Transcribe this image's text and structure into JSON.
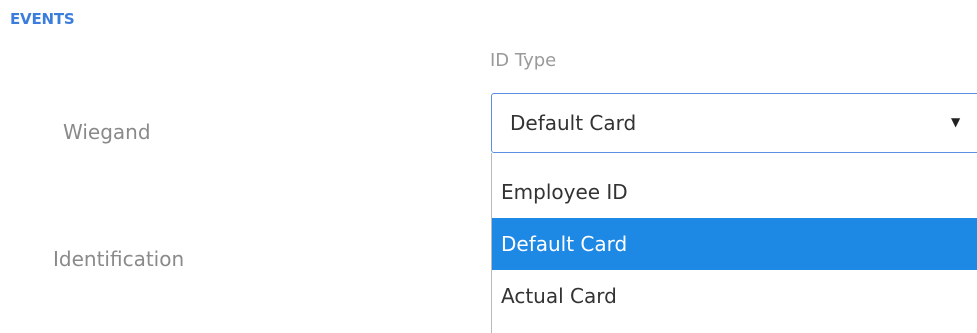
{
  "section": {
    "title": "EVENTS"
  },
  "columns": {
    "id_type_header": "ID Type"
  },
  "rows": [
    {
      "label": "Wiegand"
    },
    {
      "label": "Identification"
    }
  ],
  "id_type_select": {
    "value": "Default Card",
    "caret_icon": "caret-down-icon",
    "options": [
      "Employee ID",
      "Default Card",
      "Actual Card"
    ],
    "selected_option": "Default Card"
  },
  "colors": {
    "accent": "#3b7ddd",
    "selected_background": "#1e88e5",
    "select_border": "#5b8fe3"
  }
}
